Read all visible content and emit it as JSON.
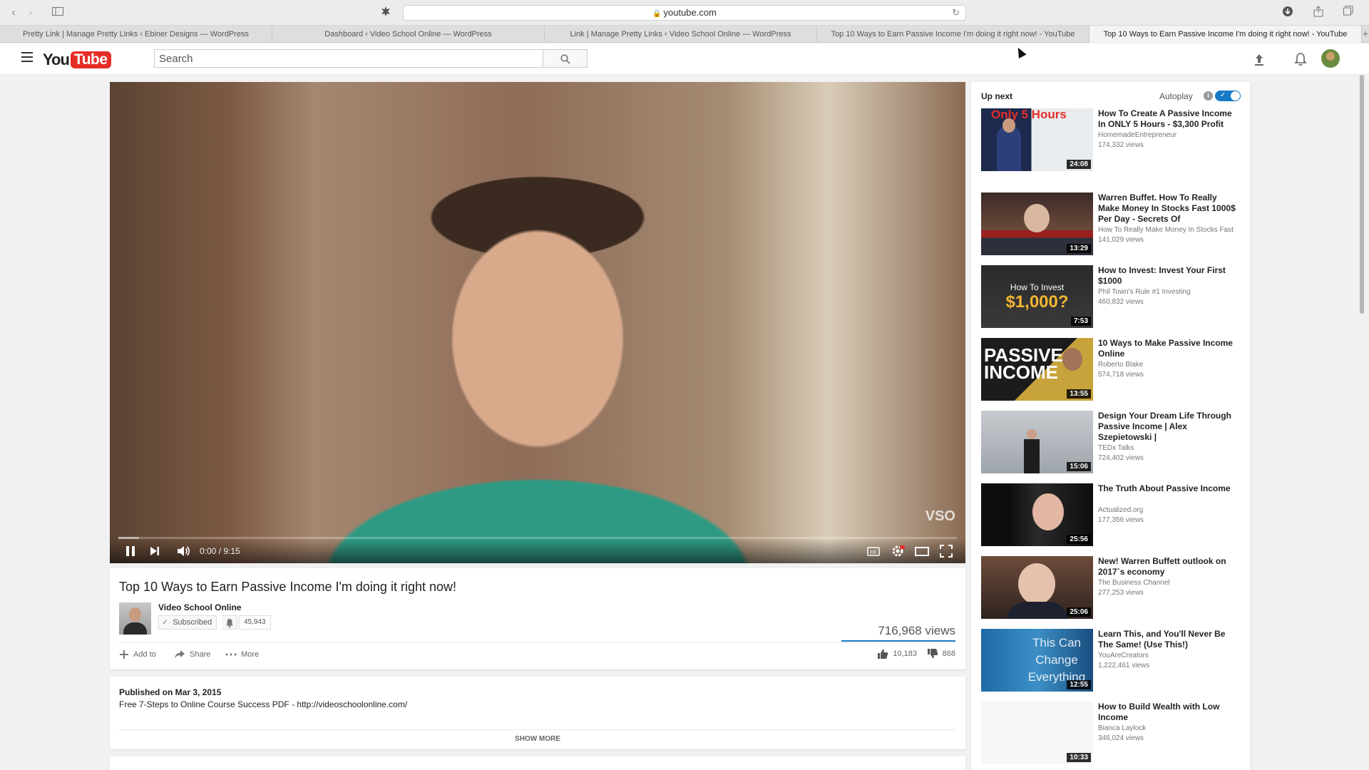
{
  "browser": {
    "url": "youtube.com",
    "tabs": [
      {
        "label": "Pretty Link | Manage Pretty Links ‹ Ebiner Designs — WordPress",
        "active": false
      },
      {
        "label": "Dashboard ‹ Video School Online — WordPress",
        "active": false
      },
      {
        "label": "Link | Manage Pretty Links ‹ Video School Online — WordPress",
        "active": false
      },
      {
        "label": "Top 10 Ways to Earn Passive Income I'm doing it right now! - YouTube",
        "active": false
      },
      {
        "label": "Top 10 Ways to Earn Passive Income I'm doing it right now! - YouTube",
        "active": true
      }
    ]
  },
  "header": {
    "logo_you": "You",
    "logo_tube": "Tube",
    "search_placeholder": "Search"
  },
  "player": {
    "watermark": "VSO",
    "time": "0:00 / 9:15",
    "progress": 0.0,
    "buffered": 0.025
  },
  "video": {
    "title": "Top 10 Ways to Earn Passive Income I'm doing it right now!",
    "channel": "Video School Online",
    "subscribed_label": "Subscribed",
    "subscriber_count": "45,943",
    "views": "716,968 views",
    "actions": {
      "add_to": "Add to",
      "share": "Share",
      "more": "More"
    },
    "likes": "10,183",
    "dislikes": "868",
    "published": "Published on Mar 3, 2015",
    "description": "Free 7-Steps to Online Course Success PDF - http://videoschoolonline.com/",
    "show_more": "SHOW MORE"
  },
  "sidebar": {
    "up_next": "Up next",
    "autoplay": "Autoplay",
    "autoplay_on": true,
    "recommendations": [
      {
        "title": "How To Create A Passive Income In ONLY 5 Hours - $3,300 Profit",
        "channel": "HomemadeEntrepreneur",
        "views": "174,332 views",
        "duration": "24:08",
        "thumb_text": "Only 5 Hours"
      },
      {
        "title": "Warren Buffet. How To Really Make Money In Stocks Fast 1000$ Per Day - Secrets Of",
        "channel": "How To Really Make Money In Stocks Fast",
        "views": "141,029 views",
        "duration": "13:29",
        "thumb_text": ""
      },
      {
        "title": "How to Invest: Invest Your First $1000",
        "channel": "Phil Town's Rule #1 Investing",
        "views": "460,832 views",
        "duration": "7:53",
        "thumb_text": "How To Invest",
        "thumb_text2": "$1,000?"
      },
      {
        "title": "10 Ways to Make Passive Income Online",
        "channel": "Roberto Blake",
        "views": "574,718 views",
        "duration": "13:55",
        "thumb_text": "PASSIVE",
        "thumb_text2": "INCOME"
      },
      {
        "title": "Design Your Dream Life Through Passive Income | Alex Szepietowski |",
        "channel": "TEDx Talks",
        "views": "724,402 views",
        "duration": "15:06",
        "thumb_text": ""
      },
      {
        "title": "The Truth About Passive Income",
        "channel": "Actualized.org",
        "views": "177,356 views",
        "duration": "25:56",
        "thumb_text": ""
      },
      {
        "title": "New! Warren Buffett outlook on 2017`s economy",
        "channel": "The Business Channel",
        "views": "277,253 views",
        "duration": "25:06",
        "thumb_text": ""
      },
      {
        "title": "Learn This, and You'll Never Be The Same! (Use This!)",
        "channel": "YouAreCreators",
        "views": "1,222,461 views",
        "duration": "12:55",
        "thumb_text": "This Can Change Everything"
      },
      {
        "title": "How to Build Wealth with Low Income",
        "channel": "Bianca Laylock",
        "views": "346,024 views",
        "duration": "10:33",
        "thumb_text": ""
      }
    ]
  }
}
